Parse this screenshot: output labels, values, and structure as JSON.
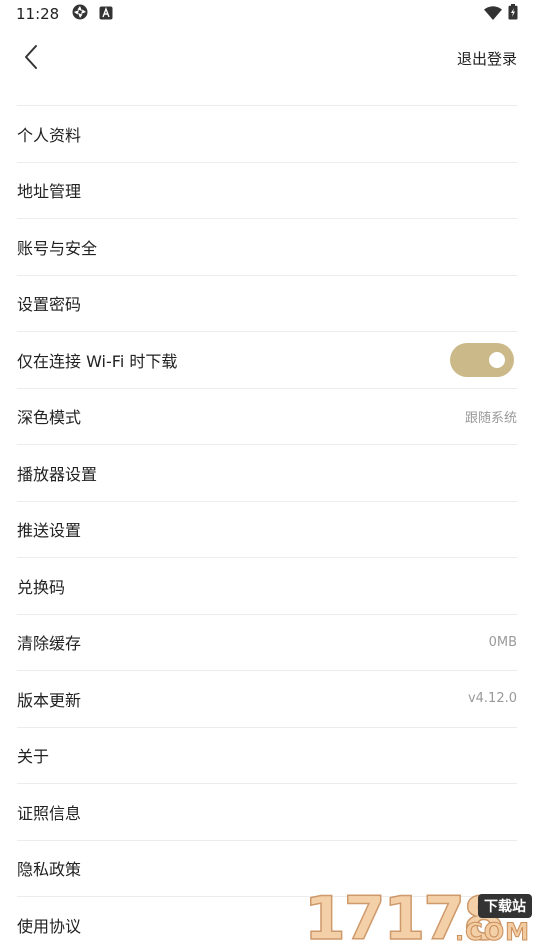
{
  "status_bar": {
    "time": "11:28",
    "icons_left": [
      "sync-icon",
      "text-a-icon"
    ],
    "icons_right": [
      "wifi-icon",
      "battery-icon"
    ]
  },
  "header": {
    "back_icon": "chevron-left-icon",
    "logout_label": "退出登录"
  },
  "items": [
    {
      "label": "个人资料",
      "value": ""
    },
    {
      "label": "地址管理",
      "value": ""
    },
    {
      "label": "账号与安全",
      "value": ""
    },
    {
      "label": "设置密码",
      "value": ""
    },
    {
      "label": "仅在连接 Wi-Fi 时下载",
      "toggle": true
    },
    {
      "label": "深色模式",
      "value": "跟随系统"
    },
    {
      "label": "播放器设置",
      "value": ""
    },
    {
      "label": "推送设置",
      "value": ""
    },
    {
      "label": "兑换码",
      "value": ""
    },
    {
      "label": "清除缓存",
      "value": "0MB"
    },
    {
      "label": "版本更新",
      "value": "v4.12.0"
    },
    {
      "label": "关于",
      "value": ""
    },
    {
      "label": "证照信息",
      "value": ""
    },
    {
      "label": "隐私政策",
      "value": ""
    },
    {
      "label": "使用协议",
      "value": ""
    }
  ],
  "colors": {
    "toggle_on": "#cbb98a",
    "divider": "#ececec",
    "secondary_text": "#9a9a9a"
  },
  "watermark": {
    "digits": "17178",
    "badge": "下载站",
    "suffix": ".COM"
  }
}
